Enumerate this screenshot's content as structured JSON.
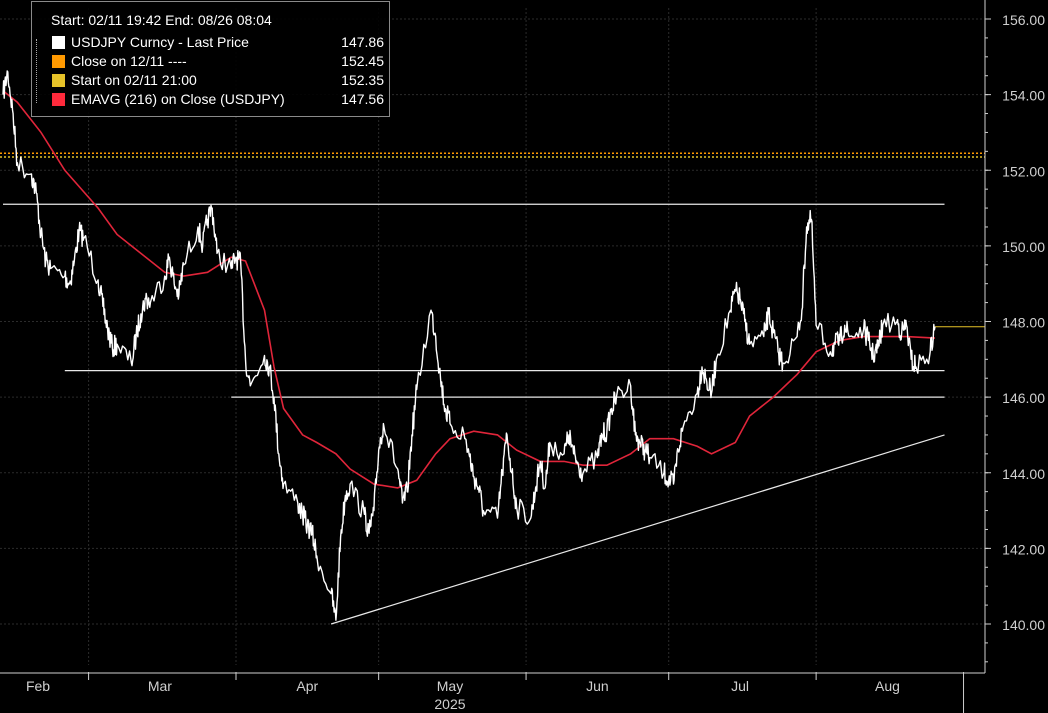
{
  "legend": {
    "header": "Start: 02/11 19:42 End: 08/26 08:04",
    "entries": [
      {
        "label": "USDJPY Curncy - Last Price",
        "value": "147.86",
        "color": "#ffffff"
      },
      {
        "label": "Close on 12/11 ----",
        "value": "152.45",
        "color": "#ff9900"
      },
      {
        "label": "Start on 02/11 21:00",
        "value": "152.35",
        "color": "#e6c229"
      },
      {
        "label": "EMAVG (216)  on Close (USDJPY)",
        "value": "147.56",
        "color": "#ff2a3c"
      }
    ]
  },
  "colors": {
    "background": "#000000",
    "grid": "#2b2b2b",
    "price": "#ffffff",
    "ema": "#e0253a",
    "close_ref": "#ff9900",
    "start_ref": "#e6c229",
    "axis": "#cfcfcf"
  },
  "chart_data": {
    "type": "line",
    "title": "",
    "xlabel": "2025",
    "ylabel": "",
    "ylim": [
      139,
      156.5
    ],
    "y_ticks": [
      "156.00",
      "154.00",
      "152.00",
      "150.00",
      "148.00",
      "146.00",
      "144.00",
      "142.00",
      "140.00"
    ],
    "x_ticks": [
      "Feb",
      "Mar",
      "Apr",
      "May",
      "Jun",
      "Jul",
      "Aug"
    ],
    "x_year_label": "2025",
    "x_start": "2025-02-11",
    "x_end": "2025-08-26",
    "series": [
      {
        "name": "USDJPY Curncy - Last Price",
        "x": [
          "2025-02-11",
          "2025-02-12",
          "2025-02-13",
          "2025-02-14",
          "2025-02-17",
          "2025-02-18",
          "2025-02-19",
          "2025-02-20",
          "2025-02-21",
          "2025-02-24",
          "2025-02-25",
          "2025-02-26",
          "2025-02-27",
          "2025-02-28",
          "2025-03-03",
          "2025-03-04",
          "2025-03-05",
          "2025-03-06",
          "2025-03-07",
          "2025-03-10",
          "2025-03-11",
          "2025-03-12",
          "2025-03-13",
          "2025-03-14",
          "2025-03-17",
          "2025-03-18",
          "2025-03-19",
          "2025-03-20",
          "2025-03-21",
          "2025-03-24",
          "2025-03-25",
          "2025-03-26",
          "2025-03-27",
          "2025-03-28",
          "2025-03-31",
          "2025-04-01",
          "2025-04-02",
          "2025-04-03",
          "2025-04-04",
          "2025-04-07",
          "2025-04-08",
          "2025-04-09",
          "2025-04-10",
          "2025-04-11",
          "2025-04-14",
          "2025-04-15",
          "2025-04-16",
          "2025-04-17",
          "2025-04-18",
          "2025-04-21",
          "2025-04-22",
          "2025-04-23",
          "2025-04-24",
          "2025-04-25",
          "2025-04-28",
          "2025-04-29",
          "2025-04-30",
          "2025-05-01",
          "2025-05-02",
          "2025-05-05",
          "2025-05-06",
          "2025-05-07",
          "2025-05-08",
          "2025-05-09",
          "2025-05-12",
          "2025-05-13",
          "2025-05-14",
          "2025-05-15",
          "2025-05-16",
          "2025-05-19",
          "2025-05-20",
          "2025-05-21",
          "2025-05-22",
          "2025-05-23",
          "2025-05-26",
          "2025-05-27",
          "2025-05-28",
          "2025-05-29",
          "2025-05-30",
          "2025-06-02",
          "2025-06-03",
          "2025-06-04",
          "2025-06-05",
          "2025-06-06",
          "2025-06-09",
          "2025-06-10",
          "2025-06-11",
          "2025-06-12",
          "2025-06-13",
          "2025-06-16",
          "2025-06-17",
          "2025-06-18",
          "2025-06-19",
          "2025-06-20",
          "2025-06-23",
          "2025-06-24",
          "2025-06-25",
          "2025-06-26",
          "2025-06-27",
          "2025-06-30",
          "2025-07-01",
          "2025-07-02",
          "2025-07-03",
          "2025-07-04",
          "2025-07-07",
          "2025-07-08",
          "2025-07-09",
          "2025-07-10",
          "2025-07-11",
          "2025-07-14",
          "2025-07-15",
          "2025-07-16",
          "2025-07-17",
          "2025-07-18",
          "2025-07-21",
          "2025-07-22",
          "2025-07-23",
          "2025-07-24",
          "2025-07-25",
          "2025-07-28",
          "2025-07-29",
          "2025-07-30",
          "2025-07-31",
          "2025-08-01",
          "2025-08-04",
          "2025-08-05",
          "2025-08-06",
          "2025-08-07",
          "2025-08-08",
          "2025-08-11",
          "2025-08-12",
          "2025-08-13",
          "2025-08-14",
          "2025-08-15",
          "2025-08-18",
          "2025-08-19",
          "2025-08-20",
          "2025-08-21",
          "2025-08-22",
          "2025-08-25",
          "2025-08-26"
        ],
        "y": [
          154.0,
          154.6,
          153.6,
          152.2,
          151.9,
          151.4,
          150.3,
          149.6,
          149.4,
          149.2,
          149.0,
          149.6,
          150.4,
          150.2,
          149.1,
          148.4,
          147.8,
          147.3,
          147.4,
          146.9,
          147.6,
          148.2,
          148.6,
          148.5,
          149.2,
          149.7,
          149.0,
          148.7,
          149.5,
          150.5,
          150.0,
          150.7,
          151.0,
          149.8,
          149.4,
          149.7,
          149.5,
          147.0,
          146.3,
          147.1,
          146.8,
          146.0,
          144.5,
          143.7,
          143.2,
          142.9,
          142.6,
          142.4,
          141.8,
          140.8,
          140.1,
          142.3,
          143.4,
          143.7,
          142.9,
          142.4,
          143.0,
          144.6,
          145.3,
          144.1,
          143.2,
          143.5,
          145.0,
          146.2,
          148.3,
          147.6,
          146.5,
          145.7,
          145.3,
          145.0,
          144.5,
          143.9,
          143.6,
          143.0,
          142.8,
          144.0,
          145.0,
          144.0,
          143.1,
          142.8,
          143.6,
          144.3,
          143.6,
          144.8,
          144.5,
          145.0,
          144.5,
          144.2,
          144.0,
          144.4,
          145.0,
          145.1,
          145.7,
          146.0,
          146.3,
          145.0,
          144.8,
          144.6,
          144.4,
          144.0,
          143.8,
          143.7,
          144.6,
          145.2,
          146.1,
          146.8,
          146.4,
          146.1,
          147.0,
          148.3,
          148.8,
          148.6,
          148.0,
          147.4,
          147.6,
          148.2,
          147.7,
          147.2,
          146.9,
          147.6,
          148.3,
          150.5,
          150.7,
          147.9,
          147.2,
          147.4,
          147.5,
          147.9,
          147.6,
          147.8,
          147.5,
          147.1,
          147.3,
          147.9,
          148.0,
          147.7,
          147.9,
          147.0,
          146.8,
          147.2,
          147.86
        ]
      },
      {
        "name": "EMAVG (216)  on Close (USDJPY)",
        "x": [
          "2025-02-11",
          "2025-02-14",
          "2025-02-19",
          "2025-02-24",
          "2025-03-03",
          "2025-03-07",
          "2025-03-12",
          "2025-03-17",
          "2025-03-21",
          "2025-03-26",
          "2025-03-31",
          "2025-04-03",
          "2025-04-07",
          "2025-04-09",
          "2025-04-11",
          "2025-04-15",
          "2025-04-18",
          "2025-04-22",
          "2025-04-25",
          "2025-04-30",
          "2025-05-05",
          "2025-05-09",
          "2025-05-13",
          "2025-05-16",
          "2025-05-21",
          "2025-05-26",
          "2025-05-30",
          "2025-06-04",
          "2025-06-09",
          "2025-06-13",
          "2025-06-18",
          "2025-06-23",
          "2025-06-27",
          "2025-07-02",
          "2025-07-07",
          "2025-07-10",
          "2025-07-15",
          "2025-07-18",
          "2025-07-23",
          "2025-07-28",
          "2025-08-01",
          "2025-08-06",
          "2025-08-11",
          "2025-08-15",
          "2025-08-20",
          "2025-08-26"
        ],
        "y": [
          154.1,
          153.8,
          153.0,
          152.0,
          151.0,
          150.3,
          149.8,
          149.3,
          149.2,
          149.3,
          149.7,
          149.6,
          148.3,
          146.8,
          145.7,
          145.0,
          144.8,
          144.5,
          144.1,
          143.7,
          143.6,
          143.8,
          144.5,
          144.9,
          145.1,
          145.0,
          144.6,
          144.3,
          144.3,
          144.2,
          144.2,
          144.5,
          144.9,
          144.9,
          144.7,
          144.5,
          144.8,
          145.5,
          146.0,
          146.6,
          147.2,
          147.5,
          147.6,
          147.6,
          147.6,
          147.56
        ]
      }
    ],
    "reference_lines": [
      {
        "label": "Close on 12/11",
        "value": 152.45
      },
      {
        "label": "Start on 02/11 21:00",
        "value": 152.35
      }
    ],
    "annotations": [
      {
        "type": "horizontal",
        "value": 151.1,
        "x_start": "2025-02-11",
        "x_end": "2025-08-28"
      },
      {
        "type": "horizontal",
        "value": 146.7,
        "x_start": "2025-02-24",
        "x_end": "2025-08-28"
      },
      {
        "type": "horizontal",
        "value": 146.0,
        "x_start": "2025-03-31",
        "x_end": "2025-08-28"
      },
      {
        "type": "trendline",
        "x_start": "2025-04-21",
        "y_start": 140.0,
        "x_end": "2025-08-28",
        "y_end": 145.0
      }
    ]
  }
}
